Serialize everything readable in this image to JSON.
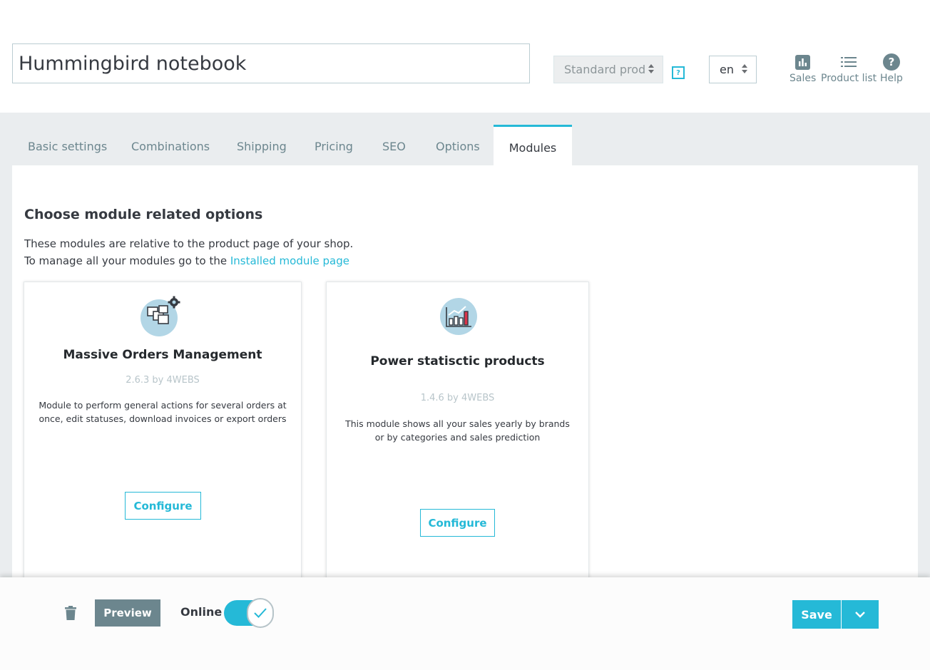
{
  "header": {
    "product_name": "Hummingbird notebook",
    "product_type": "Standard prod",
    "help_marker": "?",
    "language": "en",
    "toolbar": {
      "sales": "Sales",
      "product_list": "Product list",
      "help": "Help"
    }
  },
  "tabs": [
    {
      "label": "Basic settings",
      "active": false
    },
    {
      "label": "Combinations",
      "active": false
    },
    {
      "label": "Shipping",
      "active": false
    },
    {
      "label": "Pricing",
      "active": false
    },
    {
      "label": "SEO",
      "active": false
    },
    {
      "label": "Options",
      "active": false
    },
    {
      "label": "Modules",
      "active": true
    }
  ],
  "content": {
    "title": "Choose module related options",
    "description_line1": "These modules are relative to the product page of your shop.",
    "description_line2_prefix": "To manage all your modules go to the ",
    "description_link": "Installed module page"
  },
  "modules": [
    {
      "name": "Massive Orders Management",
      "version": "2.6.3 by 4WEBS",
      "description": "Module to perform general actions for several orders at once, edit statuses, download invoices or export orders",
      "button": "Configure",
      "icon": "boxes-gear-icon"
    },
    {
      "name": "Power statisctic products",
      "version": "1.4.6 by 4WEBS",
      "description": "This module shows all your sales yearly by brands or by categories and sales prediction",
      "button": "Configure",
      "icon": "bar-chart-icon"
    }
  ],
  "footer": {
    "preview": "Preview",
    "online_label": "Online",
    "online_enabled": true,
    "save": "Save"
  },
  "colors": {
    "accent": "#25b9d7",
    "secondary": "#6c868e",
    "text": "#363a41"
  }
}
